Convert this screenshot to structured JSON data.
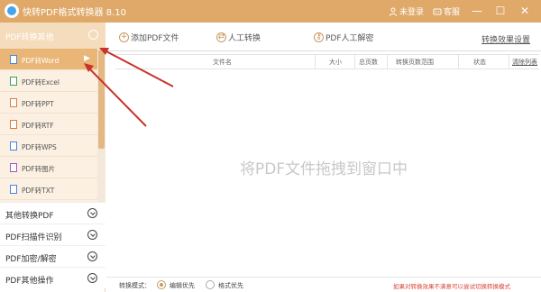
{
  "app": {
    "title": "快转PDF格式转换器 8.10",
    "user_label": "未登录",
    "service_label": "客服"
  },
  "window_controls": {
    "minimize": "—",
    "maximize": "☐",
    "close": "✕"
  },
  "sidebar": {
    "header": "PDF转换其他",
    "items": [
      {
        "label": "PDF转Word",
        "active": true,
        "icon": "word-file-icon",
        "color": "#4a86d8"
      },
      {
        "label": "PDF转Excel",
        "active": false,
        "icon": "excel-file-icon",
        "color": "#3aa35a"
      },
      {
        "label": "PDF转PPT",
        "active": false,
        "icon": "ppt-file-icon",
        "color": "#e07a3a"
      },
      {
        "label": "PDF转RTF",
        "active": false,
        "icon": "rtf-file-icon",
        "color": "#e07a3a"
      },
      {
        "label": "PDF转WPS",
        "active": false,
        "icon": "wps-file-icon",
        "color": "#4a86d8"
      },
      {
        "label": "PDF转图片",
        "active": false,
        "icon": "image-file-icon",
        "color": "#9a5ac8"
      },
      {
        "label": "PDF转TXT",
        "active": false,
        "icon": "txt-file-icon",
        "color": "#4a86d8"
      }
    ],
    "categories": [
      {
        "label": "其他转换PDF"
      },
      {
        "label": "PDF扫描件识别"
      },
      {
        "label": "PDF加密/解密"
      },
      {
        "label": "PDF其他操作"
      }
    ]
  },
  "toolbar": {
    "add_pdf": "添加PDF文件",
    "manual_convert": "人工转换",
    "manual_decrypt": "PDF人工解密",
    "effect_settings": "转换效果设置"
  },
  "table": {
    "headers": {
      "filename": "文件名",
      "size": "大小",
      "total_pages": "总页数",
      "page_range": "转换页数范围",
      "status": "状态",
      "clear_list": "清除列表"
    }
  },
  "drop_hint": "将PDF文件拖拽到窗口中",
  "statusbar": {
    "mode_label": "转换模式：",
    "option_editable": "编辑优先",
    "option_format": "格式优先",
    "selected": "editable",
    "hint": "如果对转换效果不满意可以尝试切换转换模式"
  },
  "colors": {
    "title_bar": "#e0a969",
    "sidebar_active": "#e9b677",
    "annotation_arrow": "#c8332b",
    "hint_red": "#d8473a"
  }
}
